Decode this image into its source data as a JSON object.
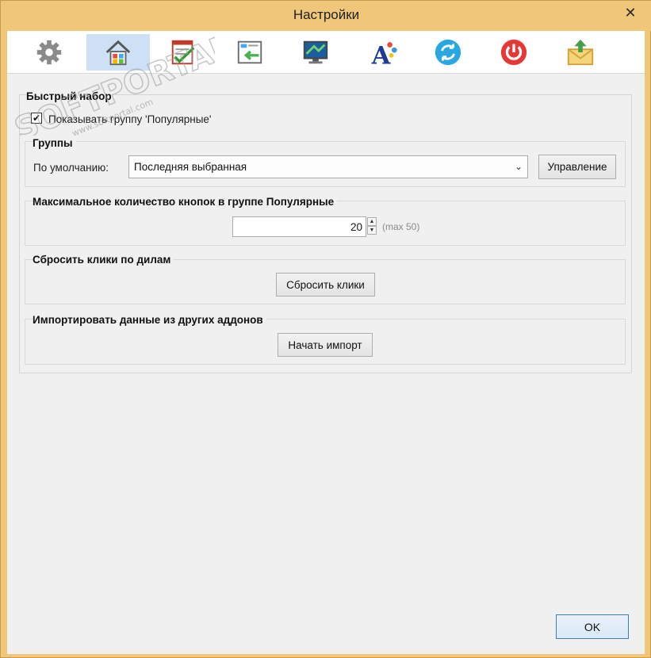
{
  "window": {
    "title": "Настройки",
    "close_glyph": "✕"
  },
  "toolbar": {
    "items": [
      {
        "icon": "gear-icon"
      },
      {
        "icon": "home-icon",
        "active": true
      },
      {
        "icon": "checklist-icon"
      },
      {
        "icon": "import-arrow-icon"
      },
      {
        "icon": "monitor-icon"
      },
      {
        "icon": "font-icon"
      },
      {
        "icon": "sync-icon"
      },
      {
        "icon": "power-icon"
      },
      {
        "icon": "mail-upload-icon"
      }
    ]
  },
  "speed_dial": {
    "title": "Быстрый набор",
    "show_popular_label": "Показывать группу 'Популярные'",
    "show_popular_checked": true
  },
  "groups": {
    "title": "Группы",
    "default_label": "По умолчанию:",
    "default_value": "Последняя выбранная",
    "manage_button": "Управление"
  },
  "max_buttons": {
    "title": "Максимальное количество кнопок в группе Популярные",
    "value": "20",
    "hint": "(max 50)"
  },
  "reset_clicks": {
    "title": "Сбросить клики по дилам",
    "button": "Сбросить клики"
  },
  "import": {
    "title": "Импортировать данные из других аддонов",
    "button": "Начать импорт"
  },
  "footer": {
    "ok_button": "OK"
  },
  "watermark": {
    "text": "SOFTPORTAL",
    "url": "www.softportal.com"
  }
}
